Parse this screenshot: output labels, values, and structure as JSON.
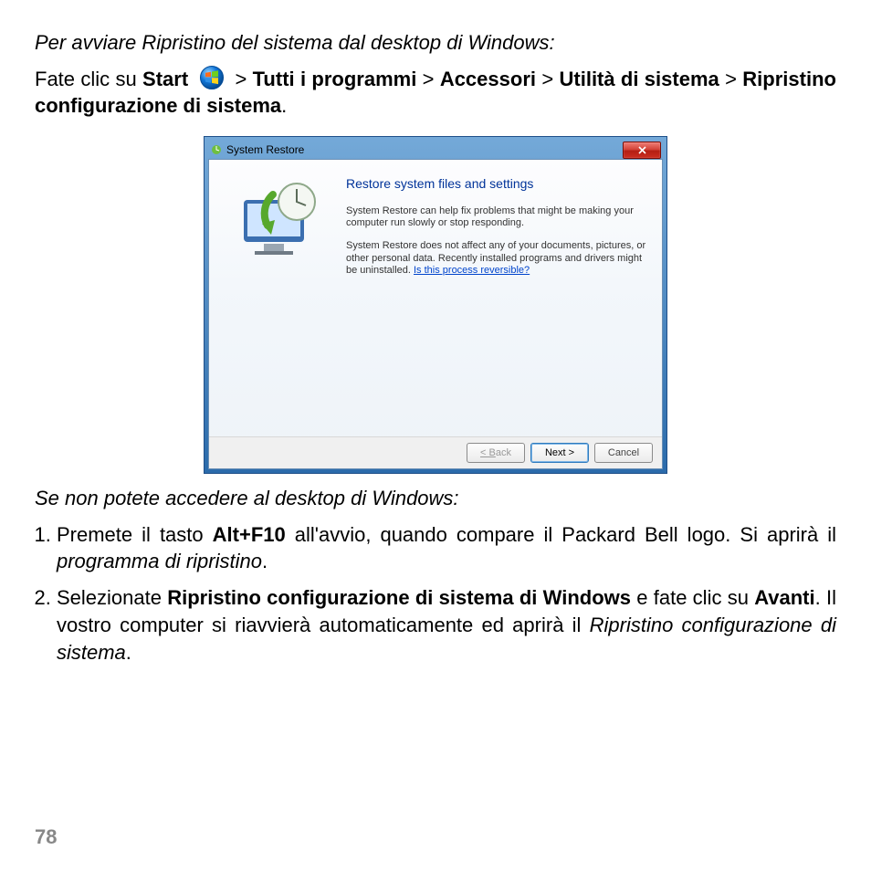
{
  "page_number": "78",
  "section1": {
    "heading": "Per avviare Ripristino del sistema dal desktop di Windows:",
    "line_prefix": "Fate clic su ",
    "start": "Start",
    "sep": " > ",
    "crumb1": "Tutti i programmi",
    "crumb2": "Accessori",
    "crumb3": "Utilità di sistema",
    "crumb4": "Ripristino configurazione di sistema"
  },
  "dialog": {
    "title": "System Restore",
    "heading": "Restore system files and settings",
    "para1": "System Restore can help fix problems that might be making your computer run slowly or stop responding.",
    "para2a": "System Restore does not affect any of your documents, pictures, or other personal data. Recently installed programs and drivers might be uninstalled. ",
    "para2_link": "Is this process reversible?",
    "buttons": {
      "back": "< Back",
      "next": "Next >",
      "cancel": "Cancel"
    }
  },
  "section2": {
    "heading": "Se non potete accedere al desktop di Windows:",
    "item1_a": "Premete il tasto ",
    "item1_b": "Alt+F10",
    "item1_c": " all'avvio, quando compare il Packard Bell logo. Si aprirà il ",
    "item1_d": "programma di ripristino",
    "item1_e": ".",
    "item2_a": "Selezionate ",
    "item2_b": "Ripristino configurazione di sistema di Windows",
    "item2_c": " e fate clic su ",
    "item2_d": "Avanti",
    "item2_e": ". Il vostro computer si riavvierà automaticamente ed aprirà il ",
    "item2_f": "Ripristino configurazione di sistema",
    "item2_g": "."
  }
}
